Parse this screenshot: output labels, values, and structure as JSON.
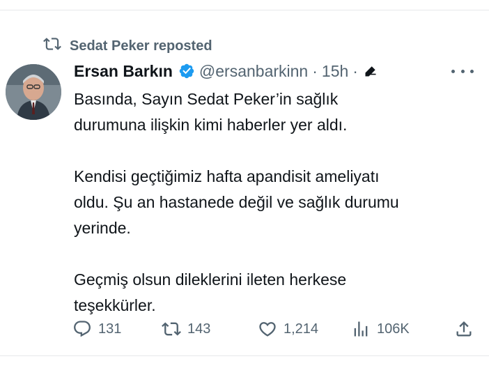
{
  "repost": {
    "icon": "repost-icon",
    "text": "Sedat Peker reposted"
  },
  "author": {
    "display_name": "Ersan Barkın",
    "verified": true,
    "handle": "@ersanbarkinn",
    "separator": "·",
    "time": "15h",
    "separator2": "·",
    "edited_icon": "edit-pencil-icon"
  },
  "menu": {
    "icon": "more-horizontal-icon"
  },
  "tweet": {
    "paragraphs": [
      [
        "Basında, Sayın Sedat Peker’in sağlık",
        "durumuna ilişkin kimi haberler yer aldı."
      ],
      [
        "Kendisi geçtiğimiz hafta apandisit ameliyatı",
        "oldu. Şu an hastanede değil ve sağlık durumu",
        "yerinde."
      ],
      [
        "Geçmiş olsun dileklerini ileten herkese",
        "teşekkürler."
      ]
    ]
  },
  "actions": {
    "replies": "131",
    "reposts": "143",
    "likes": "1,214",
    "views": "106K"
  },
  "colors": {
    "text": "#0f1419",
    "muted": "#536471",
    "verified": "#1d9bf0"
  }
}
